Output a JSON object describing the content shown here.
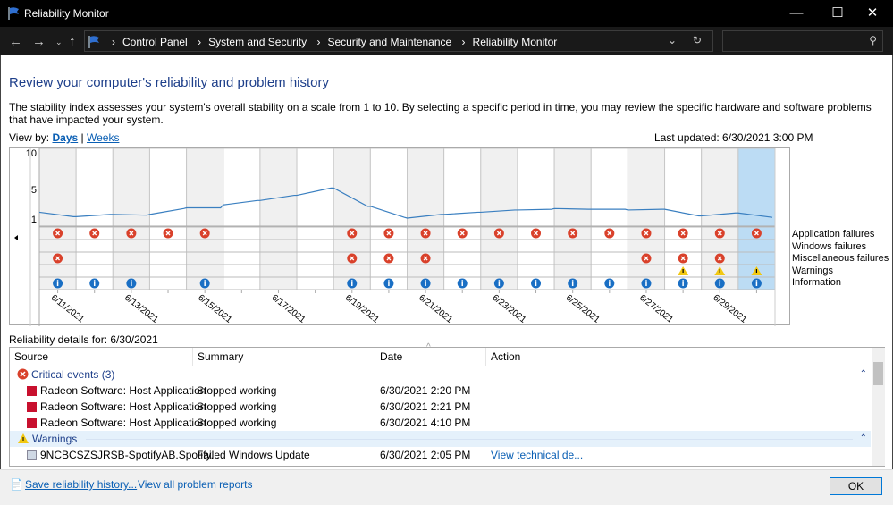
{
  "window": {
    "title": "Reliability Monitor",
    "icon": "flag-icon"
  },
  "address": {
    "crumbs": [
      "Control Panel",
      "System and Security",
      "Security and Maintenance",
      "Reliability Monitor"
    ],
    "search_placeholder": ""
  },
  "page": {
    "heading": "Review your computer's reliability and problem history",
    "description": "The stability index assesses your system's overall stability on a scale from 1 to 10. By selecting a specific period in time, you may review the specific hardware and software problems that have impacted your system.",
    "view_by_label": "View by:",
    "view_days": "Days",
    "view_sep": "|",
    "view_weeks": "Weeks",
    "last_updated": "Last updated: 6/30/2021 3:00 PM"
  },
  "chart_data": {
    "type": "line",
    "y_ticks": [
      "10",
      "5",
      "1"
    ],
    "ylim": [
      0,
      10
    ],
    "dates": [
      "6/11/2021",
      "6/12/2021",
      "6/13/2021",
      "6/14/2021",
      "6/15/2021",
      "6/16/2021",
      "6/17/2021",
      "6/18/2021",
      "6/19/2021",
      "6/20/2021",
      "6/21/2021",
      "6/22/2021",
      "6/23/2021",
      "6/24/2021",
      "6/25/2021",
      "6/26/2021",
      "6/27/2021",
      "6/28/2021",
      "6/29/2021",
      "6/30/2021"
    ],
    "x_tick_labels": [
      "6/11/2021",
      "6/13/2021",
      "6/15/2021",
      "6/17/2021",
      "6/19/2021",
      "6/21/2021",
      "6/23/2021",
      "6/25/2021",
      "6/27/2021",
      "6/29/2021"
    ],
    "stability_start": [
      1.9,
      1.3,
      1.6,
      1.6,
      2.5,
      2.9,
      3.5,
      4.2,
      5.2,
      2.7,
      1.1,
      1.6,
      1.9,
      2.2,
      2.4,
      2.3,
      2.2,
      2.3,
      1.4,
      1.8
    ],
    "stability_end": [
      1.3,
      1.6,
      1.5,
      2.4,
      2.5,
      3.5,
      4.2,
      5.2,
      2.7,
      1.2,
      1.6,
      1.9,
      2.2,
      2.3,
      2.3,
      2.3,
      2.3,
      1.4,
      1.8,
      1.2
    ],
    "selected_date": "6/30/2021",
    "rows": [
      {
        "label": "Application failures",
        "icon": "error",
        "days": [
          1,
          1,
          1,
          1,
          1,
          0,
          0,
          0,
          1,
          1,
          1,
          1,
          1,
          1,
          1,
          1,
          1,
          1,
          1,
          1
        ]
      },
      {
        "label": "Windows failures",
        "icon": "error",
        "days": [
          0,
          0,
          0,
          0,
          0,
          0,
          0,
          0,
          0,
          0,
          0,
          0,
          0,
          0,
          0,
          0,
          0,
          0,
          0,
          0
        ]
      },
      {
        "label": "Miscellaneous failures",
        "icon": "error",
        "days": [
          1,
          0,
          0,
          0,
          0,
          0,
          0,
          0,
          1,
          1,
          1,
          0,
          0,
          0,
          0,
          0,
          1,
          1,
          1,
          0
        ]
      },
      {
        "label": "Warnings",
        "icon": "warning",
        "days": [
          0,
          0,
          0,
          0,
          0,
          0,
          0,
          0,
          0,
          0,
          0,
          0,
          0,
          0,
          0,
          0,
          0,
          1,
          1,
          1
        ]
      },
      {
        "label": "Information",
        "icon": "info",
        "days": [
          1,
          1,
          1,
          0,
          1,
          0,
          0,
          0,
          1,
          1,
          1,
          1,
          1,
          1,
          1,
          1,
          1,
          1,
          1,
          1
        ]
      }
    ],
    "colors": {
      "line": "#3a7fc0",
      "error": "#d9412b",
      "warning": "#f2c811",
      "info": "#1a6fc4",
      "selected": "#bcdcf4",
      "shade": "#f0f0f0"
    }
  },
  "details": {
    "title": "Reliability details for: 6/30/2021",
    "columns": [
      "Source",
      "Summary",
      "Date",
      "Action"
    ],
    "groups": [
      {
        "label": "Critical events (3)",
        "icon": "error-icon",
        "rows": [
          {
            "source": "Radeon Software: Host Application",
            "summary": "Stopped working",
            "date": "6/30/2021 2:20 PM",
            "action": ""
          },
          {
            "source": "Radeon Software: Host Application",
            "summary": "Stopped working",
            "date": "6/30/2021 2:21 PM",
            "action": ""
          },
          {
            "source": "Radeon Software: Host Application",
            "summary": "Stopped working",
            "date": "6/30/2021 4:10 PM",
            "action": ""
          }
        ]
      },
      {
        "label": "Warnings",
        "icon": "warning-icon",
        "rows": [
          {
            "source": "9NCBCSZSJRSB-SpotifyAB.Spotify...",
            "summary": "Failed Windows Update",
            "date": "6/30/2021 2:05 PM",
            "action": "View technical de..."
          }
        ]
      }
    ]
  },
  "footer": {
    "save": "Save reliability history...",
    "view_all": "View all problem reports",
    "ok": "OK"
  }
}
